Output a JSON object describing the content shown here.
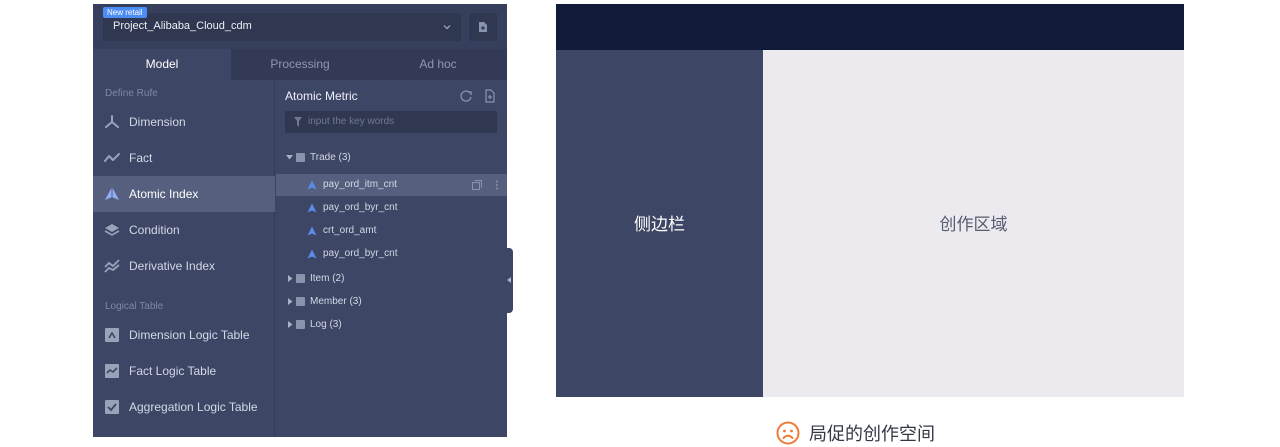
{
  "project": {
    "badge": "New retail",
    "name": "Project_Alibaba_Cloud_cdm"
  },
  "tabs": [
    {
      "label": "Model",
      "active": true
    },
    {
      "label": "Processing",
      "active": false
    },
    {
      "label": "Ad hoc",
      "active": false
    }
  ],
  "nav": {
    "section1": "Define Rufe",
    "items1": [
      {
        "label": "Dimension",
        "icon": "dimension-icon"
      },
      {
        "label": "Fact",
        "icon": "fact-icon"
      },
      {
        "label": "Atomic Index",
        "icon": "atomic-index-icon",
        "active": true
      },
      {
        "label": "Condition",
        "icon": "condition-icon"
      },
      {
        "label": "Derivative Index",
        "icon": "derivative-index-icon"
      }
    ],
    "section2": "Logical Table",
    "items2": [
      {
        "label": "Dimension Logic Table",
        "icon": "dimension-table-icon"
      },
      {
        "label": "Fact Logic Table",
        "icon": "fact-table-icon"
      },
      {
        "label": "Aggregation Logic Table",
        "icon": "aggregation-table-icon"
      }
    ]
  },
  "tree": {
    "title": "Atomic Metric",
    "search_placeholder": "input the key words",
    "groups": [
      {
        "label": "Trade (3)",
        "expanded": true,
        "children": [
          "pay_ord_itm_cnt",
          "pay_ord_byr_cnt",
          "crt_ord_amt",
          "pay_ord_byr_cnt"
        ]
      },
      {
        "label": "Item (2)",
        "expanded": false
      },
      {
        "label": "Member (3)",
        "expanded": false
      },
      {
        "label": "Log (3)",
        "expanded": false
      }
    ]
  },
  "diagram": {
    "sidebar_label": "侧边栏",
    "work_label": "创作区域",
    "caption": "局促的创作空间",
    "caption_icon": "frown-face-icon"
  },
  "colors": {
    "panel": "#3d4665",
    "header": "#111a39",
    "workspace": "#eceaee",
    "accent": "#4c8cf5",
    "caption_icon": "#f07a3a"
  }
}
